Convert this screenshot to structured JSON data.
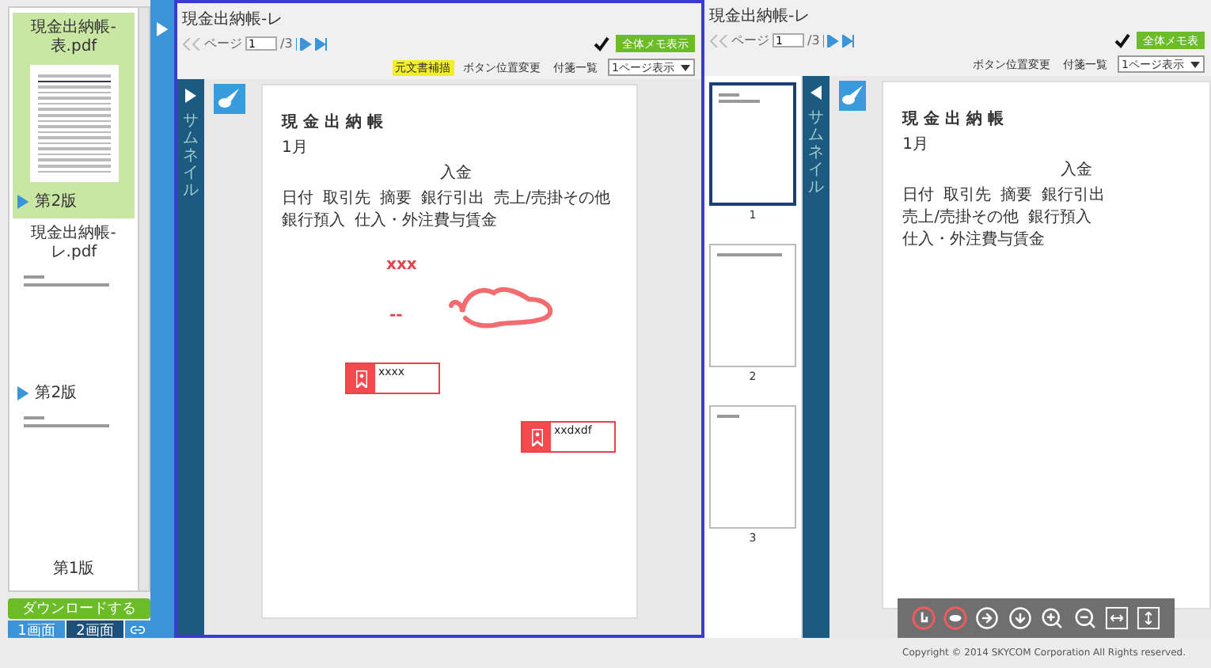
{
  "sidebar": {
    "files": [
      {
        "name": "現金出納帳-表.pdf",
        "selected": true,
        "preview": {
          "kind": "table"
        },
        "versions": [
          {
            "label": "第2版",
            "current": true
          }
        ]
      },
      {
        "name": "現金出納帳-レ.pdf",
        "selected": false,
        "preview": {
          "kind": "lines"
        },
        "versions": [
          {
            "label": "第2版",
            "current": true,
            "preview": {
              "kind": "lines"
            }
          },
          {
            "label": "第1版",
            "current": false
          }
        ]
      }
    ],
    "download_button": "ダウンロードする",
    "screen_tabs": [
      {
        "label": "1画面",
        "selected": false
      },
      {
        "label": "2画面",
        "selected": true
      }
    ]
  },
  "viewers": [
    {
      "active": true,
      "title": "現金出納帳-レ",
      "page_label": "ページ",
      "page": "1",
      "total": "/3",
      "memo_checked": true,
      "memo_button": "全体メモ表示",
      "buttons": [
        {
          "label": "元文書補描",
          "highlighted": true
        },
        {
          "label": "ボタン位置変更",
          "highlighted": false
        },
        {
          "label": "付箋一覧",
          "highlighted": false
        }
      ],
      "view_mode": "1ページ表示",
      "side_tab": "サムネイル",
      "thumbnails_open": false,
      "document": {
        "title": "現 金 出 納 帳",
        "month": "1月",
        "group": "入金",
        "columns": [
          "日付",
          "取引先",
          "摘要",
          "銀行引出",
          "売上/売掛その他",
          "銀行預入",
          "仕入・外注費与賃金"
        ]
      },
      "annotations": [
        {
          "kind": "text",
          "text": "xxx"
        },
        {
          "kind": "scribble"
        },
        {
          "kind": "text",
          "text": "--"
        },
        {
          "kind": "note",
          "text": "xxxx"
        },
        {
          "kind": "note",
          "text": "xxdxdf"
        }
      ]
    },
    {
      "active": false,
      "title": "現金出納帳-レ",
      "page_label": "ページ",
      "page": "1",
      "total": "/3",
      "memo_checked": true,
      "memo_button": "全体メモ表",
      "buttons": [
        {
          "label": "ボタン位置変更",
          "highlighted": false
        },
        {
          "label": "付箋一覧",
          "highlighted": false
        }
      ],
      "view_mode": "1ページ表示",
      "side_tab": "サムネイル",
      "thumbnails_open": true,
      "thumbnails": [
        {
          "number": "1",
          "selected": true
        },
        {
          "number": "2",
          "selected": false
        },
        {
          "number": "3",
          "selected": false
        }
      ],
      "document": {
        "title": "現 金 出 納 帳",
        "month": "1月",
        "group": "入金",
        "columns": [
          "日付",
          "取引先",
          "摘要",
          "銀行引出",
          "売上/売掛その他",
          "銀行預入",
          "仕入・外注費与賃金"
        ]
      }
    }
  ],
  "footer": {
    "copyright": "Copyright © 2014 SKYCOM Corporation All Rights reserved."
  }
}
